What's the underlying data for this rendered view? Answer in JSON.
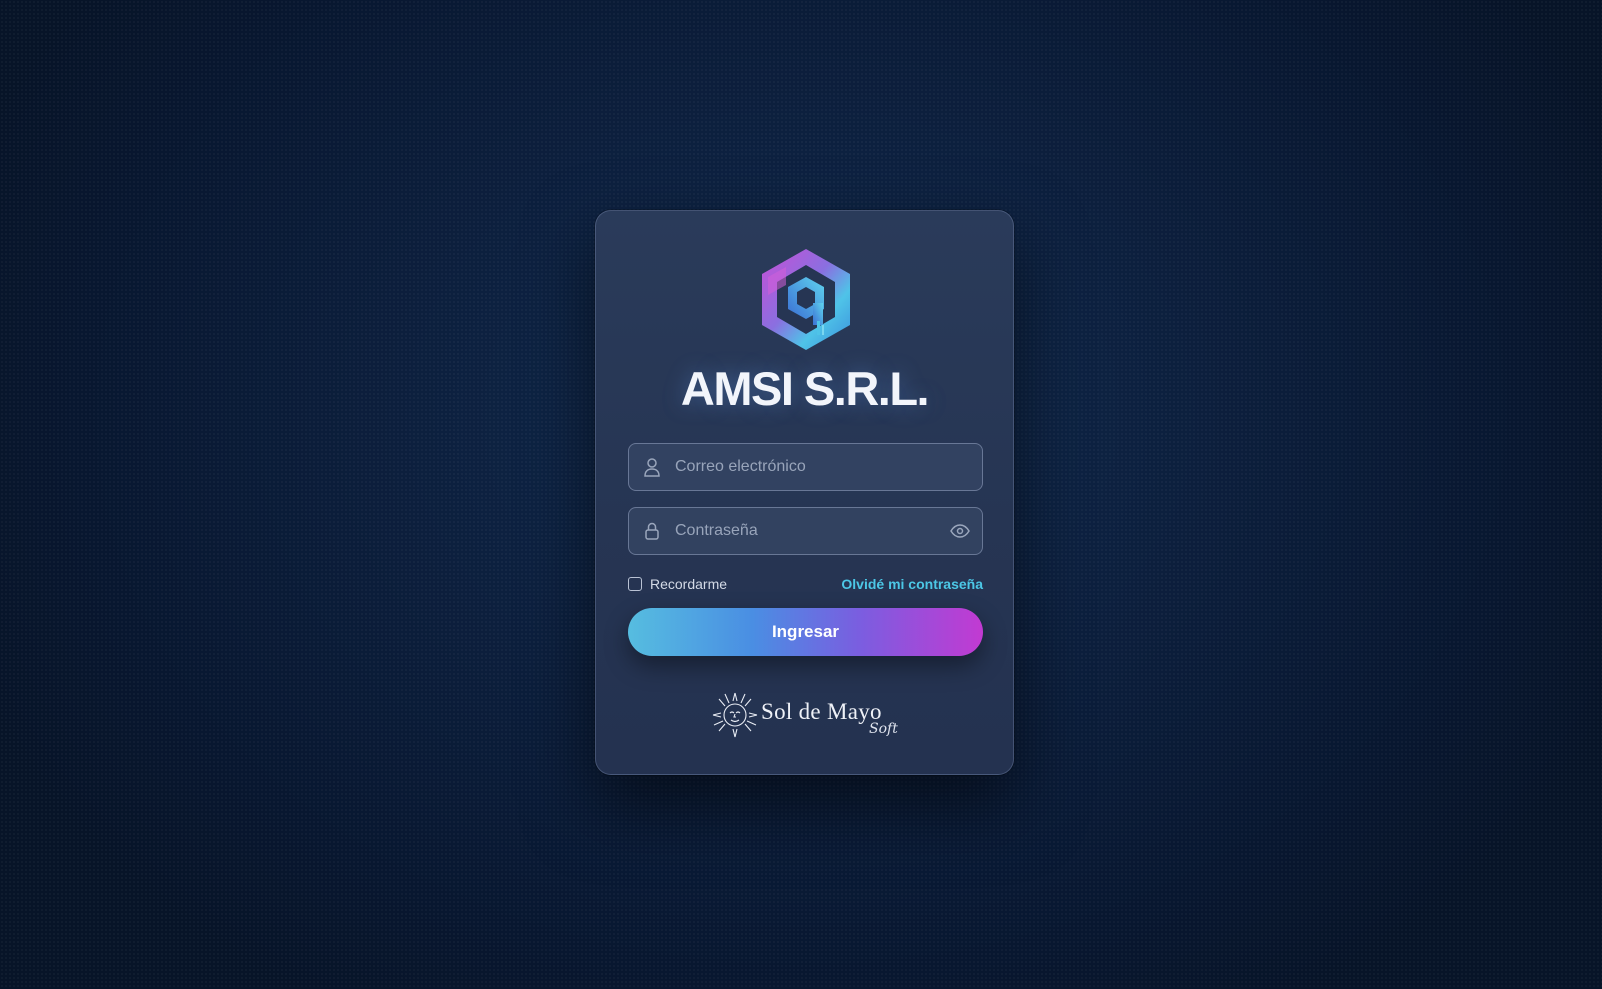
{
  "brand": {
    "name": "AMSI S.R.L.",
    "logo_icon": "amsi-hexagon-logo"
  },
  "form": {
    "email": {
      "placeholder": "Correo electrónico",
      "value": "",
      "icon": "user-icon"
    },
    "password": {
      "placeholder": "Contraseña",
      "value": "",
      "icon": "lock-icon",
      "toggle_icon": "eye-icon"
    },
    "remember_label": "Recordarme",
    "remember_checked": false,
    "forgot_label": "Olvidé mi contraseña",
    "submit_label": "Ingresar"
  },
  "footer": {
    "logo_main": "Sol de Mayo",
    "logo_sub": "Soft",
    "logo_icon": "sun-face-icon"
  },
  "colors": {
    "background": "#0c1f3d",
    "card": "#273654",
    "link": "#4cc7e6",
    "button_gradient_start": "#56bde0",
    "button_gradient_end": "#c23ad2"
  }
}
